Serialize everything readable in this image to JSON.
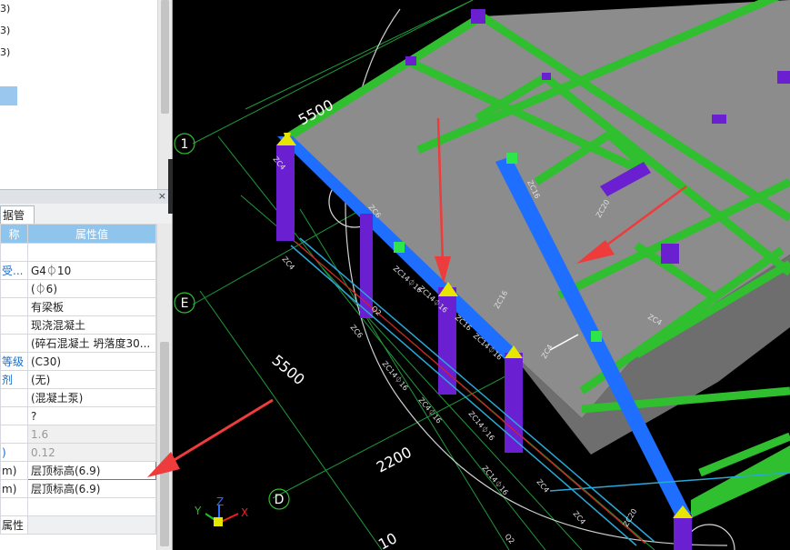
{
  "tree": {
    "items": [
      {
        "label": "3)"
      },
      {
        "label": "3)"
      },
      {
        "label": "3)"
      }
    ]
  },
  "panel": {
    "close_label": "×",
    "tab_label": "据管理"
  },
  "table": {
    "header_name": "称",
    "header_value": "属性值",
    "rows": [
      {
        "name": "",
        "value": ""
      },
      {
        "name": "受...",
        "value": "G4⏀10"
      },
      {
        "name": "",
        "value": "(⏀6)"
      },
      {
        "name": "",
        "value": "有梁板"
      },
      {
        "name": "",
        "value": "现浇混凝土"
      },
      {
        "name": "",
        "value": "(碎石混凝土 坍落度30..."
      },
      {
        "name": "等级",
        "value": "(C30)"
      },
      {
        "name": "剂",
        "value": "(无)"
      },
      {
        "name": "",
        "value": "(混凝土泵)"
      },
      {
        "name": "",
        "value": "?"
      },
      {
        "name": "",
        "value": "1.6"
      },
      {
        "name": ")",
        "value": "0.12"
      },
      {
        "name": "m)",
        "value": "层顶标高(6.9)"
      },
      {
        "name": "m)",
        "value": "层顶标高(6.9)"
      },
      {
        "name": "",
        "value": ""
      },
      {
        "name": "属性",
        "value": ""
      }
    ]
  },
  "viewport": {
    "axis_labels": {
      "one": "1",
      "e": "E",
      "d": "D"
    },
    "dimensions": {
      "d1": "5500",
      "d2": "5500",
      "d3": "2200",
      "d4": "10"
    },
    "annotations": {
      "a1": "ZC4",
      "a2": "ZC6",
      "a3": "ZC6",
      "a4": "ZC4",
      "a5": "ZC14⏀16",
      "a6": "ZC14⏀16",
      "a7": "Q2",
      "a8": "ZC14⏀16",
      "a9": "ZC4",
      "a10": "ZC16",
      "a11": "ZC16",
      "a12": "ZC4",
      "a13": "ZC16",
      "a14": "ZC14⏀16",
      "a15": "ZC4⏀16",
      "a16": "ZC14⏀16",
      "a17": "ZC14⏀16",
      "a18": "ZC4",
      "a19": "ZC4",
      "a20": "Q2",
      "a21": "ZC20",
      "a22": "ZC20"
    },
    "gizmo": {
      "x": "X",
      "y": "Y",
      "z": "Z"
    }
  },
  "colors": {
    "slab": "#8c8c8c",
    "beam_green": "#2fbf2f",
    "beam_blue": "#1e6fff",
    "column_purple": "#6a1fd0",
    "arrow_red": "#ee3b3b"
  }
}
